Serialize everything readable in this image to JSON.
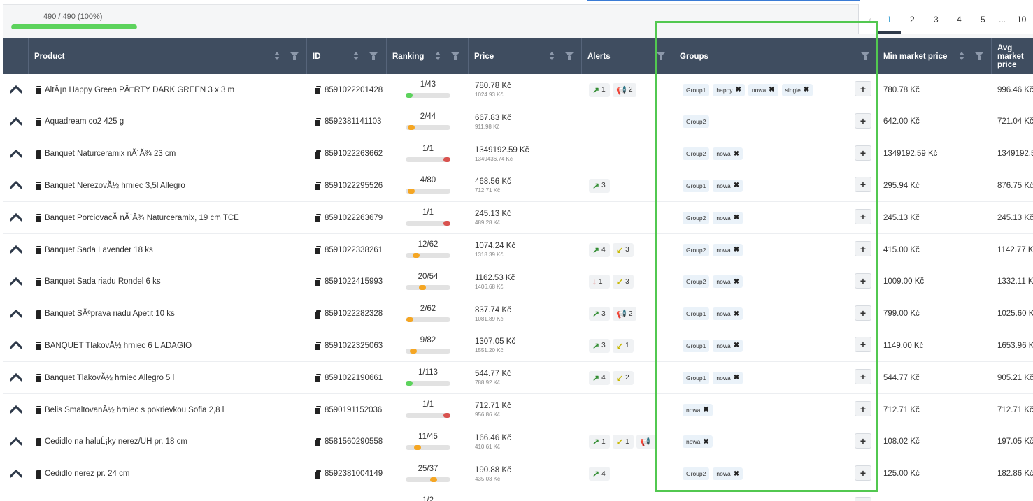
{
  "progress": {
    "label": "490 / 490 (100%)",
    "percent": 100
  },
  "pagination": {
    "prev": "‹",
    "pages": [
      "1",
      "2",
      "3",
      "4",
      "5",
      "...",
      "10"
    ],
    "active": "1"
  },
  "columns": {
    "product": "Product",
    "id": "ID",
    "ranking": "Ranking",
    "price": "Price",
    "alerts": "Alerts",
    "groups": "Groups",
    "min_market": "Min market price",
    "avg_market": "Avg market price"
  },
  "colors": {
    "green": "#5dd35d",
    "orange": "#f5a623",
    "red": "#d9534f",
    "header": "#3f4d60",
    "highlight": "#52c850"
  },
  "rows": [
    {
      "product": "AltĂ¡n Happy Green PĂ□RTY DARK GREEN 3 x 3 m",
      "id": "8591022201428",
      "rank": "1/43",
      "rank_pos": 0.0,
      "rank_color": "green",
      "price": "780.78 Kč",
      "price_sub": "1024.93 Kč",
      "alerts": [
        {
          "icon": "↗",
          "color": "#2e8b2e",
          "count": "1"
        },
        {
          "icon": "📢",
          "color": "#4caf50",
          "count": "2"
        }
      ],
      "groups": [
        {
          "name": "Group1",
          "x": false
        },
        {
          "name": "happy",
          "x": true
        },
        {
          "name": "nowa",
          "x": true
        },
        {
          "name": "single",
          "x": true
        }
      ],
      "min": "780.78 Kč",
      "avg": "996.46 Kč"
    },
    {
      "product": "Aquadream co2 425 g",
      "id": "8592381141103",
      "rank": "2/44",
      "rank_pos": 0.05,
      "rank_color": "orange",
      "price": "667.83 Kč",
      "price_sub": "911.98 Kč",
      "alerts": [],
      "groups": [
        {
          "name": "Group2",
          "x": false
        }
      ],
      "min": "642.00 Kč",
      "avg": "721.04 Kč"
    },
    {
      "product": "Banquet Naturceramix nĂ´Ă¾ 23 cm",
      "id": "8591022263662",
      "rank": "1/1",
      "rank_pos": 1.0,
      "rank_color": "red",
      "price": "1349192.59 Kč",
      "price_sub": "1349436.74 Kč",
      "alerts": [],
      "groups": [
        {
          "name": "Group2",
          "x": false
        },
        {
          "name": "nowa",
          "x": true
        }
      ],
      "min": "1349192.59 Kč",
      "avg": "1349192.5"
    },
    {
      "product": "Banquet NerezovĂ½ hrniec 3,5l Allegro",
      "id": "8591022295526",
      "rank": "4/80",
      "rank_pos": 0.05,
      "rank_color": "orange",
      "price": "468.56 Kč",
      "price_sub": "712.71 Kč",
      "alerts": [
        {
          "icon": "↗",
          "color": "#2e8b2e",
          "count": "3"
        }
      ],
      "groups": [
        {
          "name": "Group1",
          "x": false
        },
        {
          "name": "nowa",
          "x": true
        }
      ],
      "min": "295.94 Kč",
      "avg": "876.75 Kč"
    },
    {
      "product": "Banquet PorciovacĂ nĂ´Ă¾ Naturceramix, 19 cm TCE",
      "id": "8591022263679",
      "rank": "1/1",
      "rank_pos": 1.0,
      "rank_color": "red",
      "price": "245.13 Kč",
      "price_sub": "489.28 Kč",
      "alerts": [],
      "groups": [
        {
          "name": "Group2",
          "x": false
        },
        {
          "name": "nowa",
          "x": true
        }
      ],
      "min": "245.13 Kč",
      "avg": "245.13 Kč"
    },
    {
      "product": "Banquet Sada Lavender 18 ks",
      "id": "8591022338261",
      "rank": "12/62",
      "rank_pos": 0.18,
      "rank_color": "orange",
      "price": "1074.24 Kč",
      "price_sub": "1318.39 Kč",
      "alerts": [
        {
          "icon": "↗",
          "color": "#2e8b2e",
          "count": "4"
        },
        {
          "icon": "↙",
          "color": "#c8b800",
          "count": "3"
        }
      ],
      "groups": [
        {
          "name": "Group2",
          "x": false
        },
        {
          "name": "nowa",
          "x": true
        }
      ],
      "min": "415.00 Kč",
      "avg": "1142.77 Kč"
    },
    {
      "product": "Banquet Sada riadu Rondel 6 ks",
      "id": "8591022415993",
      "rank": "20/54",
      "rank_pos": 0.35,
      "rank_color": "orange",
      "price": "1162.53 Kč",
      "price_sub": "1406.68 Kč",
      "alerts": [
        {
          "icon": "↓",
          "color": "#d9534f",
          "count": "1"
        },
        {
          "icon": "↙",
          "color": "#c8b800",
          "count": "3"
        }
      ],
      "groups": [
        {
          "name": "Group2",
          "x": false
        },
        {
          "name": "nowa",
          "x": true
        }
      ],
      "min": "1009.00 Kč",
      "avg": "1332.11 Kč"
    },
    {
      "product": "Banquet SĂºprava riadu Apetit 10 ks",
      "id": "8591022282328",
      "rank": "2/62",
      "rank_pos": 0.02,
      "rank_color": "orange",
      "price": "837.74 Kč",
      "price_sub": "1081.89 Kč",
      "alerts": [
        {
          "icon": "↗",
          "color": "#2e8b2e",
          "count": "3"
        },
        {
          "icon": "📢",
          "color": "#4caf50",
          "count": "2"
        }
      ],
      "groups": [
        {
          "name": "Group1",
          "x": false
        },
        {
          "name": "nowa",
          "x": true
        }
      ],
      "min": "799.00 Kč",
      "avg": "1025.60 Kč"
    },
    {
      "product": "BANQUET TlakovĂ½ hrniec 6 L ADAGIO",
      "id": "8591022325063",
      "rank": "9/82",
      "rank_pos": 0.12,
      "rank_color": "orange",
      "price": "1307.05 Kč",
      "price_sub": "1551.20 Kč",
      "alerts": [
        {
          "icon": "↗",
          "color": "#2e8b2e",
          "count": "3"
        },
        {
          "icon": "↙",
          "color": "#c8b800",
          "count": "1"
        }
      ],
      "groups": [
        {
          "name": "Group1",
          "x": false
        },
        {
          "name": "nowa",
          "x": true
        }
      ],
      "min": "1149.00 Kč",
      "avg": "1653.96 Kč"
    },
    {
      "product": "Banquet TlakovĂ½ hrniec Allegro 5 l",
      "id": "8591022190661",
      "rank": "1/113",
      "rank_pos": 0.0,
      "rank_color": "green",
      "price": "544.77 Kč",
      "price_sub": "788.92 Kč",
      "alerts": [
        {
          "icon": "↗",
          "color": "#2e8b2e",
          "count": "4"
        },
        {
          "icon": "↙",
          "color": "#c8b800",
          "count": "2"
        }
      ],
      "groups": [
        {
          "name": "Group1",
          "x": false
        },
        {
          "name": "nowa",
          "x": true
        }
      ],
      "min": "544.77 Kč",
      "avg": "905.21 Kč"
    },
    {
      "product": "Belis SmaltovanĂ½ hrniec s pokrievkou Sofia 2,8 l",
      "id": "8590191152036",
      "rank": "1/1",
      "rank_pos": 1.0,
      "rank_color": "red",
      "price": "712.71 Kč",
      "price_sub": "956.86 Kč",
      "alerts": [],
      "groups": [
        {
          "name": "nowa",
          "x": true
        }
      ],
      "min": "712.71 Kč",
      "avg": "712.71 Kč"
    },
    {
      "product": "Cedidlo na haluĹ¡ky nerez/UH pr. 18 cm",
      "id": "8581560290558",
      "rank": "11/45",
      "rank_pos": 0.22,
      "rank_color": "orange",
      "price": "166.46 Kč",
      "price_sub": "410.61 Kč",
      "alerts": [
        {
          "icon": "↗",
          "color": "#2e8b2e",
          "count": "1"
        },
        {
          "icon": "↙",
          "color": "#c8b800",
          "count": "1"
        },
        {
          "icon": "📢",
          "color": "#4caf50",
          "count": ""
        }
      ],
      "groups": [
        {
          "name": "nowa",
          "x": true
        }
      ],
      "min": "108.02 Kč",
      "avg": "197.05 Kč"
    },
    {
      "product": "Cedidlo nerez pr. 24 cm",
      "id": "8592381004149",
      "rank": "25/37",
      "rank_pos": 0.65,
      "rank_color": "orange",
      "price": "190.88 Kč",
      "price_sub": "435.03 Kč",
      "alerts": [
        {
          "icon": "↗",
          "color": "#2e8b2e",
          "count": "4"
        }
      ],
      "groups": [
        {
          "name": "Group2",
          "x": false
        },
        {
          "name": "nowa",
          "x": true
        }
      ],
      "min": "125.00 Kč",
      "avg": "182.86 Kč"
    },
    {
      "product": "",
      "id": "",
      "rank": "1/2",
      "rank_pos": 0.0,
      "rank_color": "green",
      "price": "",
      "price_sub": "",
      "alerts": [],
      "groups": [],
      "min": "",
      "avg": ""
    }
  ]
}
